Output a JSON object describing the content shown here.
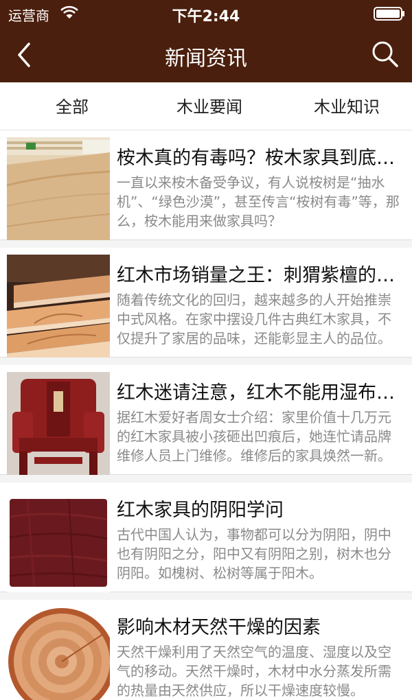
{
  "status": {
    "carrier": "运营商",
    "time": "下午2:44"
  },
  "nav": {
    "title": "新闻资讯",
    "back_icon": "chevron-left-icon",
    "search_icon": "search-icon"
  },
  "tabs": [
    {
      "label": "全部"
    },
    {
      "label": "木业要闻"
    },
    {
      "label": "木业知识"
    }
  ],
  "articles": [
    {
      "title": "桉木真的有毒吗？桉木家具到底好不好",
      "desc": "一直以来桉木备受争议，有人说桉树是“抽水机”、“绿色沙漠”，甚至传言“桉树有毒”等，那么，桉木能用来做家具吗？"
    },
    {
      "title": "红木市场销量之王：刺猬紫檀的魅力",
      "desc": "随着传统文化的回归，越来越多的人开始推崇中式风格。在家中摆设几件古典红木家具，不仅提升了家居的品味，还能彰显主人的品位。"
    },
    {
      "title": "红木迷请注意，红木不能用湿布擦拭",
      "desc": "据红木爱好者周女士介绍：家里价值十几万元的红木家具被小孩砸出凹痕后，她连忙请品牌维修人员上门维修。维修后的家具焕然一新。"
    },
    {
      "title": "红木家具的阴阳学问",
      "desc": "古代中国人认为，事物都可以分为阴阳，阴中也有阴阳之分，阳中又有阴阳之别，树木也分阴阳。如槐树、松树等属于阳木。"
    },
    {
      "title": "影响木材天然干燥的因素",
      "desc": "天然干燥利用了天然空气的温度、湿度以及空气的移动。天然干燥时，木材中水分蒸发所需的热量由天然供应，所以干燥速度较慢。"
    }
  ]
}
